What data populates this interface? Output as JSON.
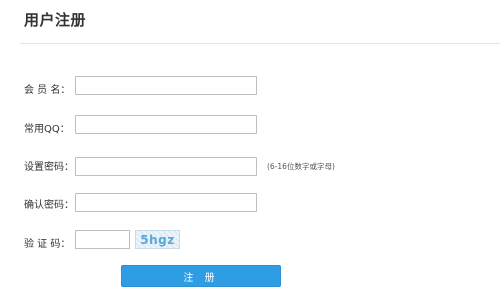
{
  "page": {
    "title": "用户注册"
  },
  "form": {
    "member_name_label": "会 员 名：",
    "member_name_value": "",
    "qq_label": "常用QQ：",
    "qq_value": "",
    "password_label": "设置密码：",
    "password_value": "",
    "password_hint": "(6-16位数字或字母)",
    "confirm_password_label": "确认密码：",
    "confirm_password_value": "",
    "captcha_label": "验 证 码：",
    "captcha_value": "",
    "captcha_image_text": "5hgz",
    "submit_label": "注 册"
  },
  "colors": {
    "accent": "#2e9de4",
    "input_border": "#bfbfbf",
    "divider": "#e6e6e6"
  }
}
